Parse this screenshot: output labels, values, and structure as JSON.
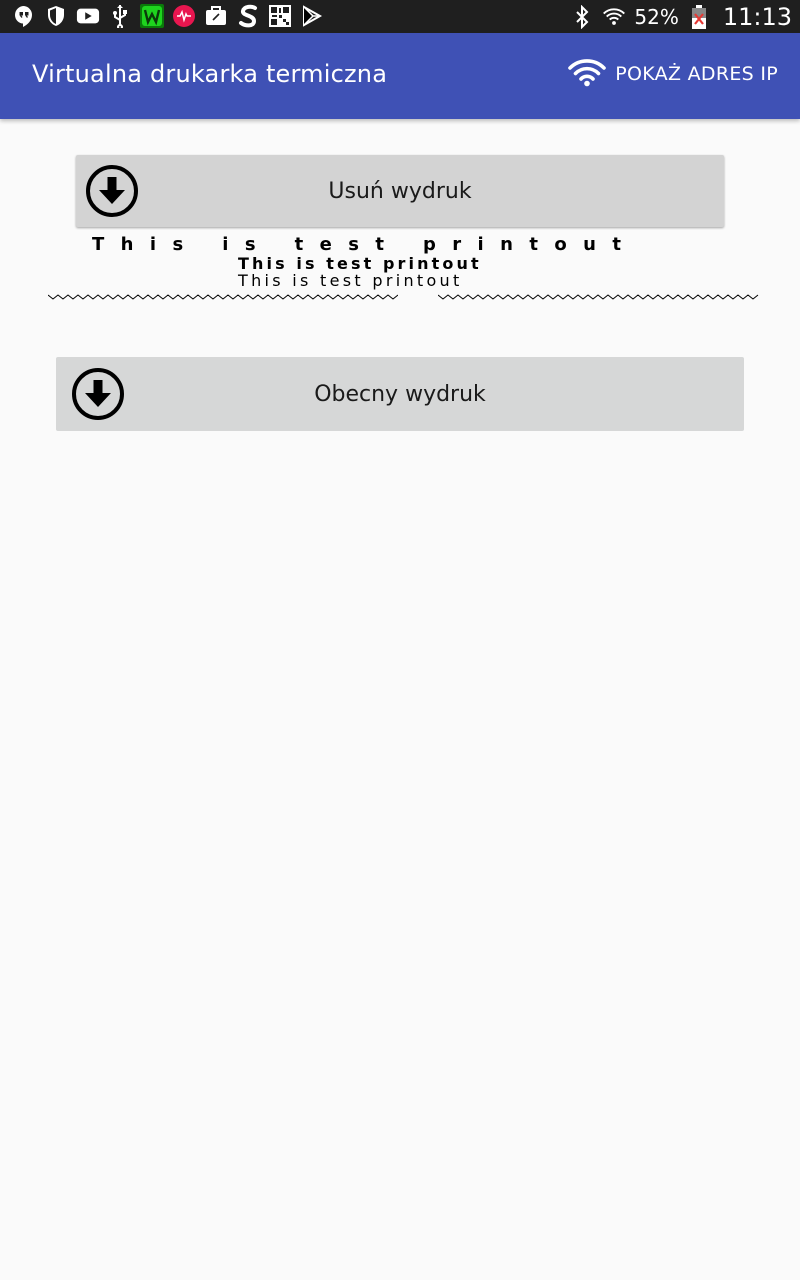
{
  "status_bar": {
    "icons": [
      "hangouts-icon",
      "shield-icon",
      "youtube-icon",
      "usb-icon",
      "wattpad-icon",
      "musically-icon",
      "briefcase-icon",
      "s-app-icon",
      "qr-icon",
      "play-store-icon"
    ],
    "battery_percent": "52%",
    "time": "11:13"
  },
  "app_bar": {
    "title": "Virtualna drukarka termiczna",
    "show_ip_label": "POKAŻ ADRES IP",
    "background": "#3f51b5"
  },
  "buttons": {
    "delete_label": "Usuń wydruk",
    "current_label": "Obecny wydruk"
  },
  "printout": {
    "line1": "This is test printout",
    "line2": "This is test printout",
    "line3": "This is test printout"
  }
}
